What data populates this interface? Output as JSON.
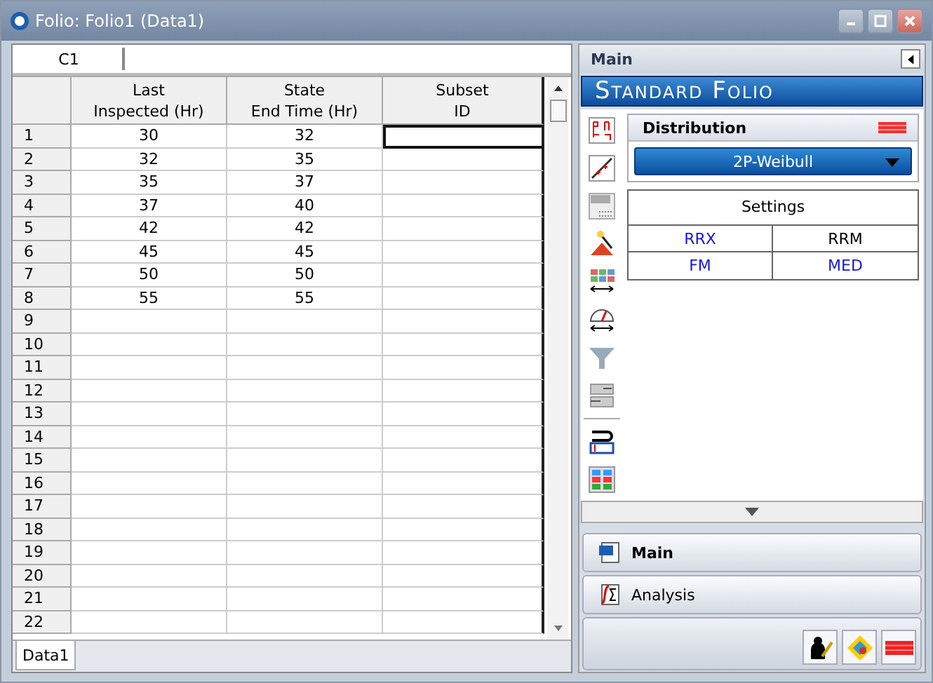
{
  "window": {
    "title": "Folio: Folio1 (Data1)"
  },
  "sheet": {
    "cell_ref": "C1",
    "columns": [
      {
        "lines": [
          "Last",
          "Inspected (Hr)"
        ]
      },
      {
        "lines": [
          "State",
          "End Time (Hr)"
        ]
      },
      {
        "lines": [
          "Subset",
          "ID"
        ]
      }
    ],
    "rows": [
      {
        "label": "1",
        "values": [
          "30",
          "32"
        ],
        "subset_selected": true
      },
      {
        "label": "2",
        "values": [
          "32",
          "35"
        ],
        "subset_selected": false
      },
      {
        "label": "3",
        "values": [
          "35",
          "37"
        ],
        "subset_selected": false
      },
      {
        "label": "4",
        "values": [
          "37",
          "40"
        ],
        "subset_selected": false
      },
      {
        "label": "5",
        "values": [
          "42",
          "42"
        ],
        "subset_selected": false
      },
      {
        "label": "6",
        "values": [
          "45",
          "45"
        ],
        "subset_selected": false
      },
      {
        "label": "7",
        "values": [
          "50",
          "50"
        ],
        "subset_selected": false
      },
      {
        "label": "8",
        "values": [
          "55",
          "55"
        ],
        "subset_selected": false
      },
      {
        "label": "9",
        "subset_selected": false
      },
      {
        "label": "10",
        "subset_selected": false
      },
      {
        "label": "11",
        "subset_selected": false
      },
      {
        "label": "12",
        "subset_selected": false
      },
      {
        "label": "13",
        "subset_selected": false
      },
      {
        "label": "14",
        "subset_selected": false
      },
      {
        "label": "15",
        "subset_selected": false
      },
      {
        "label": "16",
        "subset_selected": false
      },
      {
        "label": "17",
        "subset_selected": false
      },
      {
        "label": "18",
        "subset_selected": false
      },
      {
        "label": "19",
        "subset_selected": false
      },
      {
        "label": "20",
        "subset_selected": false
      },
      {
        "label": "21",
        "subset_selected": false
      },
      {
        "label": "22",
        "subset_selected": false
      }
    ],
    "tabs": [
      {
        "label": "Data1",
        "selected": true
      }
    ]
  },
  "panel": {
    "header": "Main",
    "banner": "Standard Folio",
    "distribution": {
      "title": "Distribution",
      "value": "2P-Weibull"
    },
    "settings": {
      "title": "Settings",
      "options": [
        {
          "label": "RRX",
          "selected": false
        },
        {
          "label": "RRM",
          "selected": true
        },
        {
          "label": "FM",
          "selected": false
        },
        {
          "label": "MED",
          "selected": false
        }
      ]
    },
    "nav": [
      {
        "label": "Main",
        "selected": true
      },
      {
        "label": "Analysis",
        "selected": false
      }
    ]
  }
}
